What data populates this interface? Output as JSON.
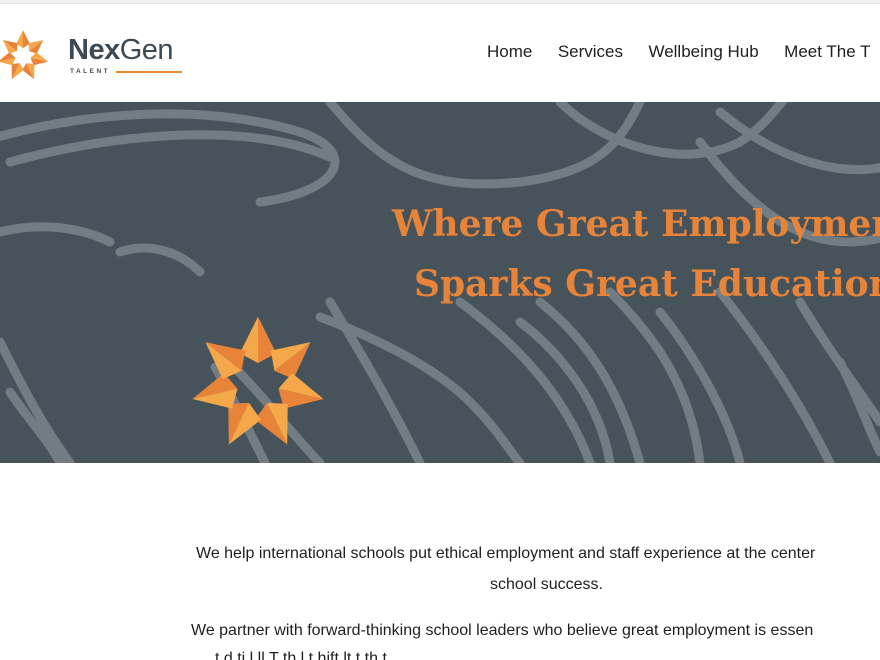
{
  "brand": {
    "name_bold": "Nex",
    "name_regular": "Gen",
    "tagline": "TALENT",
    "accent_color": "#e8843a",
    "dark_color": "#3c4a55"
  },
  "nav": {
    "items": [
      {
        "label": "Home"
      },
      {
        "label": "Services"
      },
      {
        "label": "Wellbeing Hub"
      },
      {
        "label": "Meet The T"
      }
    ]
  },
  "hero": {
    "title_line1": "Where Great Employment",
    "title_line2": "Sparks Great Education",
    "background_color": "#47535a",
    "icon": "star-logo-icon"
  },
  "content": {
    "paragraph1_line1": "We help international schools put ethical employment and staff experience at the center",
    "paragraph1_line2": "school success.",
    "paragraph2_line1": "We partner with forward-thinking school leaders who believe great employment is essen",
    "paragraph2_line2": "t     d    ti      l       ll       T    th               l t    hift  lt           t         th        t"
  }
}
